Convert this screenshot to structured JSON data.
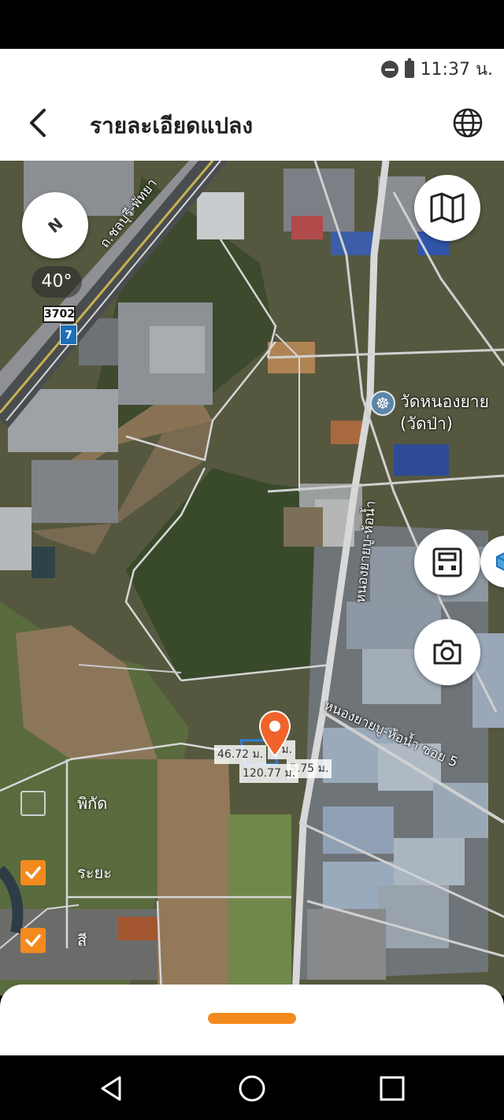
{
  "status_bar": {
    "time": "11:37 น."
  },
  "header": {
    "title": "รายละเอียดแปลง",
    "back_icon": "chevron-left-icon",
    "globe_icon": "globe-icon"
  },
  "map": {
    "compass_label": "N",
    "tilt_angle": "40°",
    "road_shield_number": "3702",
    "road_shield_route": "7",
    "road_labels": [
      "ถ.ชลบุรี-พัทยา",
      "หนองยายบู-ห้อน้ำ",
      "หนองยายบู-ห้อน้ำ ซอย 5"
    ],
    "temple": {
      "line1": "วัดหนองยาย",
      "line2": "(วัดป่า)",
      "icon": "dharma-wheel-icon"
    },
    "plot_dimensions": [
      "46.72 ม.",
      "5 ม.",
      "120.77 ม.",
      "5.75 ม."
    ],
    "pin_color": "#f0632b",
    "buttons": {
      "map_type_icon": "map-icon",
      "measure_icon": "measure-icon",
      "camera_icon": "camera-icon",
      "cube_icon": "cube-icon"
    }
  },
  "layer_toggles": [
    {
      "label": "พิกัด",
      "checked": false
    },
    {
      "label": "ระยะ",
      "checked": true
    },
    {
      "label": "สี",
      "checked": true
    }
  ],
  "accent_color": "#f28a1e"
}
